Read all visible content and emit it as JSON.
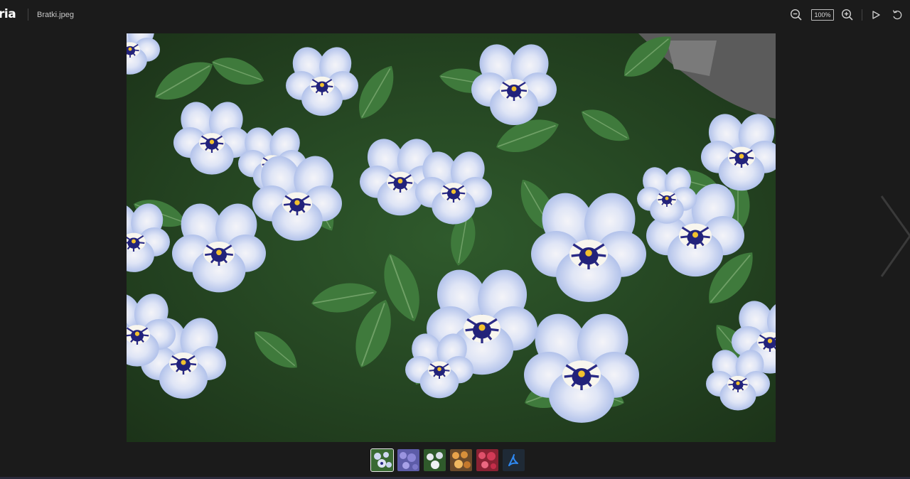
{
  "app": {
    "logo_text": "ria",
    "file_name": "Bratki.jpeg"
  },
  "toolbar": {
    "zoom_label": "100%",
    "icons": [
      "zoom-out-icon",
      "zoom-in-icon",
      "play-icon",
      "rotate-icon"
    ]
  },
  "colors": {
    "background": "#1b1b1b",
    "petal": "#b9c8ef",
    "leaf": "#3f7a3c",
    "pdf_accent": "#2f88f0"
  },
  "thumbnails": [
    {
      "name": "thumbnail-1",
      "selected": true
    },
    {
      "name": "thumbnail-2",
      "selected": false
    },
    {
      "name": "thumbnail-3",
      "selected": false
    },
    {
      "name": "thumbnail-4",
      "selected": false
    },
    {
      "name": "thumbnail-5",
      "selected": false
    },
    {
      "name": "thumbnail-pdf",
      "selected": false
    }
  ]
}
